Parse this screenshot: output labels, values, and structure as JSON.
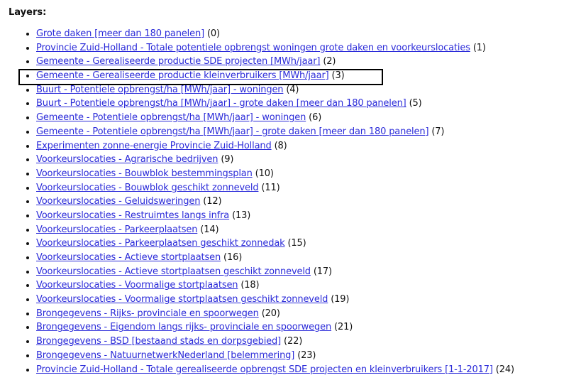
{
  "heading": "Layers:",
  "layers": [
    {
      "label": "Grote daken [meer dan 180 panelen]",
      "count": "(0)"
    },
    {
      "label": "Provincie Zuid-Holland - Totale potentiele opbrengst woningen grote daken en voorkeurslocaties",
      "count": "(1)"
    },
    {
      "label": "Gemeente - Gerealiseerde productie SDE projecten [MWh/jaar]",
      "count": "(2)"
    },
    {
      "label": "Gemeente - Gerealiseerde productie kleinverbruikers [MWh/jaar]",
      "count": "(3)"
    },
    {
      "label": "Buurt - Potentiele opbrengst/ha [MWh/jaar] - woningen",
      "count": "(4)"
    },
    {
      "label": "Buurt - Potentiele opbrengst/ha [MWh/jaar] - grote daken [meer dan 180 panelen]",
      "count": "(5)"
    },
    {
      "label": "Gemeente - Potentiele opbrengst/ha [MWh/jaar] - woningen",
      "count": "(6)"
    },
    {
      "label": "Gemeente - Potentiele opbrengst/ha [MWh/jaar] - grote daken [meer dan 180 panelen]",
      "count": "(7)"
    },
    {
      "label": "Experimenten zonne-energie Provincie Zuid-Holland",
      "count": "(8)"
    },
    {
      "label": "Voorkeurslocaties - Agrarische bedrijven",
      "count": "(9)"
    },
    {
      "label": "Voorkeurslocaties - Bouwblok bestemmingsplan",
      "count": "(10)"
    },
    {
      "label": "Voorkeurslocaties - Bouwblok geschikt zonneveld",
      "count": "(11)"
    },
    {
      "label": "Voorkeurslocaties - Geluidsweringen",
      "count": "(12)"
    },
    {
      "label": "Voorkeurslocaties - Restruimtes langs infra",
      "count": "(13)"
    },
    {
      "label": "Voorkeurslocaties - Parkeerplaatsen",
      "count": "(14)"
    },
    {
      "label": "Voorkeurslocaties - Parkeerplaatsen geschikt zonnedak",
      "count": "(15)"
    },
    {
      "label": "Voorkeurslocaties - Actieve stortplaatsen",
      "count": "(16)"
    },
    {
      "label": "Voorkeurslocaties - Actieve stortplaatsen geschikt zonneveld",
      "count": "(17)"
    },
    {
      "label": "Voorkeurslocaties - Voormalige stortplaatsen",
      "count": "(18)"
    },
    {
      "label": "Voorkeurslocaties - Voormalige stortplaatsen geschikt zonneveld",
      "count": "(19)"
    },
    {
      "label": "Brongegevens - Rijks- provinciale en spoorwegen",
      "count": "(20)"
    },
    {
      "label": "Brongegevens - Eigendom langs rijks- provinciale en spoorwegen",
      "count": "(21)"
    },
    {
      "label": "Brongegevens - BSD [bestaand stads en dorpsgebied]",
      "count": "(22)"
    },
    {
      "label": "Brongegevens - NatuurnetwerkNederland [belemmering]",
      "count": "(23)"
    },
    {
      "label": "Provincie Zuid-Holland - Totale gerealiseerde opbrengst SDE projecten en kleinverbruikers [1-1-2017]",
      "count": "(24)"
    }
  ]
}
